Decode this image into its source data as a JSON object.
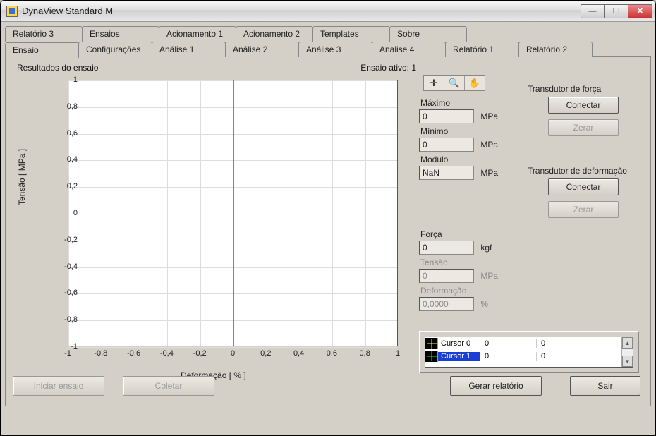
{
  "window": {
    "title": "DynaView Standard M"
  },
  "tabs_row1": [
    "Relatório 3",
    "Ensaios",
    "Acionamento 1",
    "Acionamento 2",
    "Templates",
    "Sobre"
  ],
  "tabs_row2": [
    "Ensaio",
    "Configurações",
    "Análise 1",
    "Análise 2",
    "Análise 3",
    "Analise 4",
    "Relatório 1",
    "Relatório 2"
  ],
  "active_tab": "Ensaio",
  "header": {
    "left": "Resultados do ensaio",
    "right": "Ensaio ativo: 1"
  },
  "chart_data": {
    "type": "line",
    "title": "Resultados do ensaio",
    "xlabel": "Deformação [ % ]",
    "ylabel": "Tensão [ MPa ]",
    "xlim": [
      -1,
      1
    ],
    "ylim": [
      -1,
      1
    ],
    "xticks": [
      -1,
      -0.8,
      -0.6,
      -0.4,
      -0.2,
      0,
      0.2,
      0.4,
      0.6,
      0.8,
      1
    ],
    "yticks": [
      -1,
      -0.8,
      -0.6,
      -0.4,
      -0.2,
      0,
      0.2,
      0.4,
      0.6,
      0.8,
      1
    ],
    "series": []
  },
  "readouts": {
    "maximo": {
      "label": "Máximo",
      "value": "0",
      "unit": "MPa"
    },
    "minimo": {
      "label": "Mínimo",
      "value": "0",
      "unit": "MPa"
    },
    "modulo": {
      "label": "Modulo",
      "value": "NaN",
      "unit": "MPa"
    },
    "forca": {
      "label": "Força",
      "value": "0",
      "unit": "kgf"
    },
    "tensao": {
      "label": "Tensão",
      "value": "0",
      "unit": "MPa"
    },
    "deformacao": {
      "label": "Deformação",
      "value": "0,0000",
      "unit": "%"
    }
  },
  "transducers": {
    "forca": {
      "label": "Transdutor de força",
      "connect": "Conectar",
      "zero": "Zerar"
    },
    "deformacao": {
      "label": "Transdutor de deformação",
      "connect": "Conectar",
      "zero": "Zerar"
    }
  },
  "cursors": [
    {
      "name": "Cursor 0",
      "x": "0",
      "y": "0"
    },
    {
      "name": "Cursor 1",
      "x": "0",
      "y": "0"
    }
  ],
  "actions": {
    "iniciar": "Iniciar ensaio",
    "coletar": "Coletar",
    "gerar": "Gerar relatório",
    "sair": "Sair"
  }
}
